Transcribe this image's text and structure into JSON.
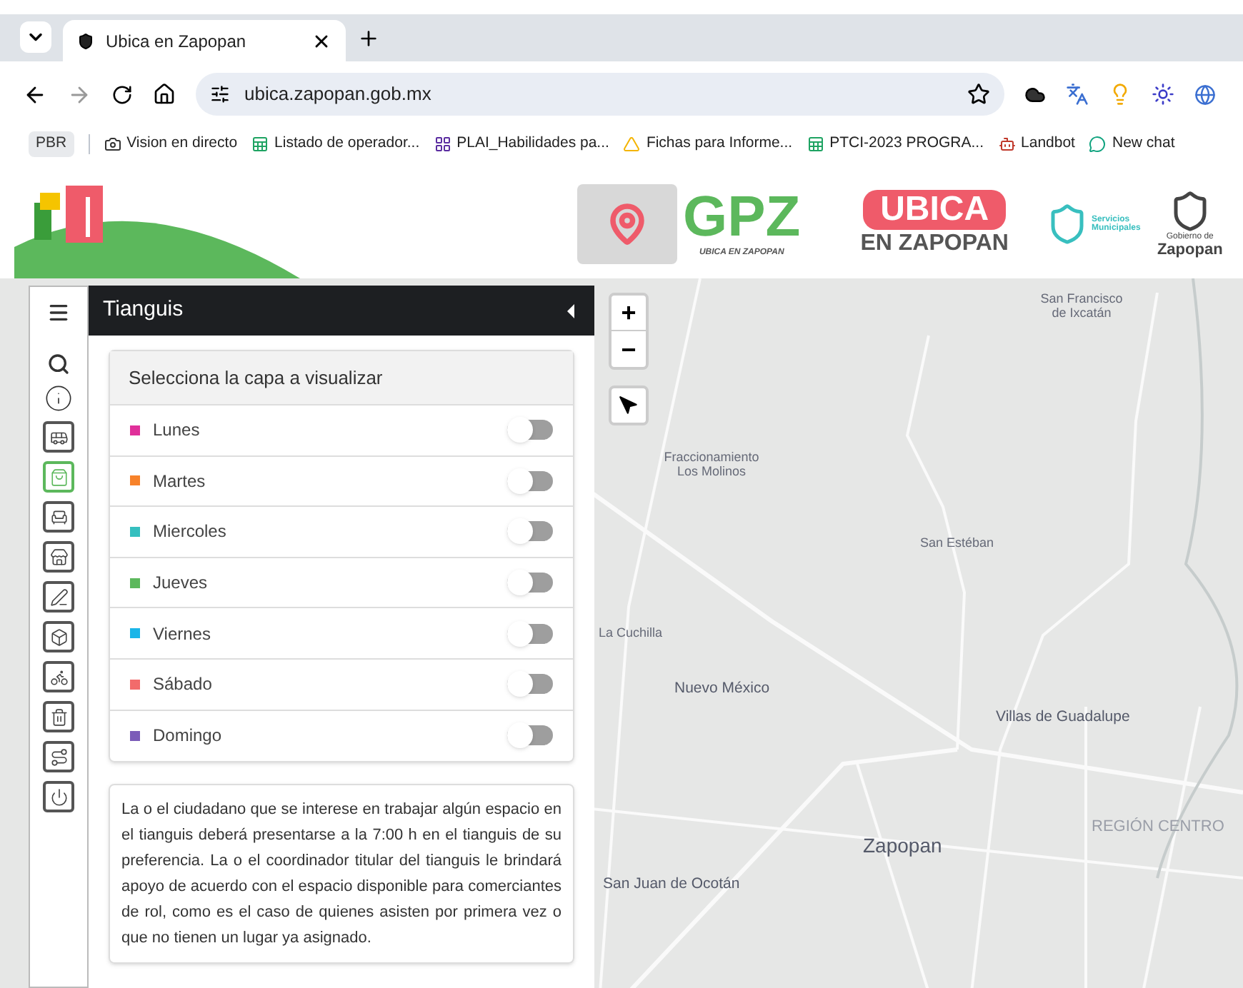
{
  "browser": {
    "tab_title": "Ubica en Zapopan",
    "url": "ubica.zapopan.gob.mx",
    "bookmarks": [
      {
        "label": "PBR",
        "kind": "chip"
      },
      {
        "label": "Vision en directo",
        "kind": "camera"
      },
      {
        "label": "Listado de operador...",
        "kind": "sheet"
      },
      {
        "label": "PLAI_Habilidades pa...",
        "kind": "app"
      },
      {
        "label": "Fichas para Informe...",
        "kind": "drive"
      },
      {
        "label": "PTCI-2023 PROGRA...",
        "kind": "sheet"
      },
      {
        "label": "Landbot",
        "kind": "bot"
      },
      {
        "label": "New chat",
        "kind": "chat"
      }
    ]
  },
  "header": {
    "gpz_logo": {
      "title": "GPZ",
      "subtitle": "UBICA EN ZAPOPAN"
    },
    "ubica_logo": {
      "line_1": "UBICA",
      "line_2": "EN ZAPOPAN"
    },
    "services_logo": {
      "caption": "Servicios Municipales"
    },
    "government_logo": {
      "caption_1": "Gobierno de",
      "caption_2": "Zapopan"
    }
  },
  "sidebar": {
    "items": [
      {
        "kind": "menu",
        "selected": false
      },
      {
        "kind": "search",
        "selected": false
      },
      {
        "kind": "info",
        "selected": false
      },
      {
        "kind": "bus",
        "selected": false
      },
      {
        "kind": "bag",
        "selected": true
      },
      {
        "kind": "park",
        "selected": false
      },
      {
        "kind": "store",
        "selected": false
      },
      {
        "kind": "pen",
        "selected": false
      },
      {
        "kind": "box",
        "selected": false
      },
      {
        "kind": "bike",
        "selected": false
      },
      {
        "kind": "trash",
        "selected": false
      },
      {
        "kind": "road",
        "selected": false
      },
      {
        "kind": "power",
        "selected": false
      }
    ]
  },
  "panel": {
    "title": "Tianguis",
    "layers_card": {
      "heading": "Selecciona la capa a visualizar",
      "layers": [
        {
          "name": "Lunes",
          "color": "#e0309a",
          "on": false
        },
        {
          "name": "Martes",
          "color": "#f7822a",
          "on": false
        },
        {
          "name": "Miercoles",
          "color": "#35bfbf",
          "on": false
        },
        {
          "name": "Jueves",
          "color": "#5cb85c",
          "on": false
        },
        {
          "name": "Viernes",
          "color": "#1bb5e8",
          "on": false
        },
        {
          "name": "Sábado",
          "color": "#f26b6b",
          "on": false
        },
        {
          "name": "Domingo",
          "color": "#7b5cb8",
          "on": false
        }
      ]
    },
    "info_text": "La o el ciudadano que se interese en trabajar algún espacio en el tianguis deberá presentarse a la 7:00 h en el tianguis de su preferencia. La o el coordinador titular del tianguis le brindará apoyo de acuerdo con el espacio disponible para comerciantes de rol, como es el caso de quienes asisten por primera vez o que no tienen un lugar ya asignado."
  },
  "map": {
    "zoom_in": "+",
    "zoom_out": "−",
    "places": [
      {
        "label": "San Francisco de Ixcatán",
        "kind": "small"
      },
      {
        "label": "Fraccionamiento Los Molinos",
        "kind": "small"
      },
      {
        "label": "San Estéban",
        "kind": "small"
      },
      {
        "label": "La Cuchilla",
        "kind": "small"
      },
      {
        "label": "Nuevo México",
        "kind": "medium"
      },
      {
        "label": "Villas de Guadalupe",
        "kind": "medium"
      },
      {
        "label": "Zapopan",
        "kind": "large"
      },
      {
        "label": "REGIÓN CENTRO",
        "kind": "region"
      },
      {
        "label": "San Juan de Ocotán",
        "kind": "medium"
      }
    ]
  }
}
